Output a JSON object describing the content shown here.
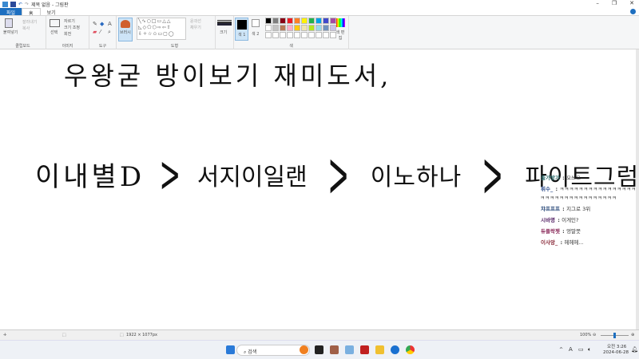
{
  "window": {
    "title": "제목 없음 - 그림판",
    "minimize": "–",
    "maximize": "❐",
    "close": "✕"
  },
  "tabs": [
    "파일",
    "홈",
    "보기"
  ],
  "ribbon": {
    "clipboard": {
      "label": "클립보드",
      "paste": "붙여넣기",
      "cut": "잘라내기",
      "copy": "복사"
    },
    "image": {
      "label": "이미지",
      "select": "선택",
      "crop": "자르기",
      "resize": "크기 조정",
      "rotate": "회전"
    },
    "tools": {
      "label": "도구"
    },
    "brushes": {
      "label": "브러시"
    },
    "shapes": {
      "label": "도형",
      "outline": "윤곽선",
      "fill": "채우기"
    },
    "size": {
      "label": "크기"
    },
    "colors": {
      "label": "색",
      "color1": "색 1",
      "color2": "색 2",
      "edit": "색 편집",
      "palette": [
        "#000000",
        "#7f7f7f",
        "#880015",
        "#ed1c24",
        "#ff7f27",
        "#fff200",
        "#22b14c",
        "#00a2e8",
        "#3f48cc",
        "#a349a4",
        "#ffffff",
        "#c3c3c3",
        "#b97a57",
        "#ffaec9",
        "#ffc90e",
        "#efe4b0",
        "#b5e61d",
        "#99d9ea",
        "#7092be",
        "#c8bfe7"
      ]
    }
  },
  "canvas": {
    "line1": "우왕굳 방이보기 재미도서,",
    "line2": [
      "이내별D",
      "서지이일랜",
      "이노하나",
      "파이트그럼"
    ],
    "separator": ">",
    "chat": [
      {
        "name": "출가방가",
        "msg": "오쓰오",
        "color": "#2a6a6a"
      },
      {
        "name": "휘수_",
        "msg": "ㅋㅋㅋㅋㅋㅋㅋㅋㅋㅋㅋㅋㅋㅋㅋㅋㅋㅋㅋㅋㅋㅋㅋㅋㅋㅋㅋㅋㅋㅋㅋㅋ",
        "color": "#2a4a8a"
      },
      {
        "name": "챠프프프",
        "msg": "지그로 3위",
        "color": "#2a4a7a"
      },
      {
        "name": "시바명",
        "msg": "이게인?",
        "color": "#5a2a6a"
      },
      {
        "name": "듀플락젯",
        "msg": "엉말쯧",
        "color": "#8a2a5a"
      },
      {
        "name": "이사앙_",
        "msg": "헤헤헤...",
        "color": "#8a2a3a"
      }
    ]
  },
  "status": {
    "dimensions": "1922 × 1077px",
    "zoom": "100%"
  },
  "taskbar": {
    "search": "검색",
    "time": "오전 3:26",
    "date": "2024-06-28",
    "lang": "A"
  }
}
